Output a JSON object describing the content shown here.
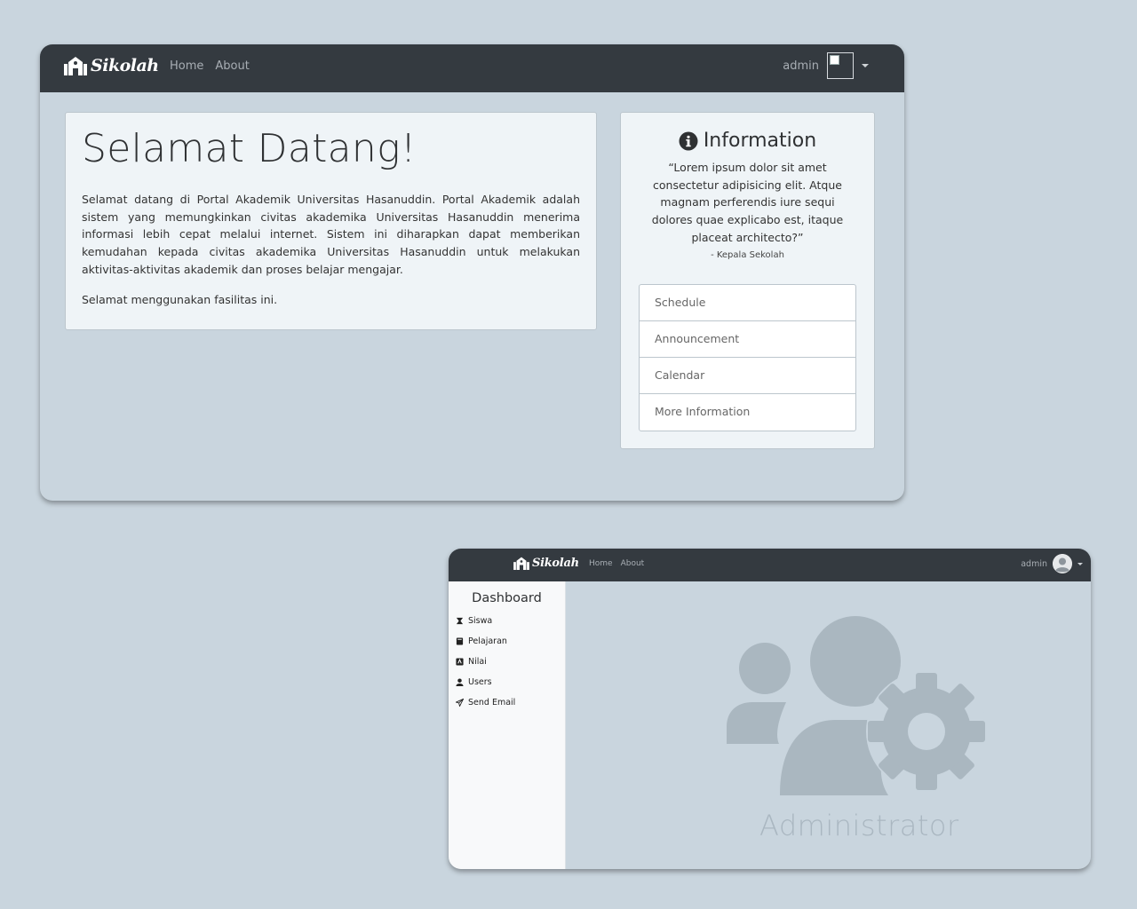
{
  "home_window": {
    "navbar": {
      "brand": "Sikolah",
      "links": [
        "Home",
        "About"
      ],
      "user_name": "admin"
    },
    "welcome": {
      "heading": "Selamat Datang!",
      "paragraph1": "Selamat datang di Portal Akademik Universitas Hasanuddin. Portal Akademik adalah sistem yang memungkinkan civitas akademika Universitas Hasanuddin menerima informasi lebih cepat melalui internet. Sistem ini diharapkan dapat memberikan kemudahan kepada civitas akademika Universitas Hasanuddin untuk melakukan aktivitas-aktivitas akademik dan proses belajar mengajar.",
      "paragraph2": "Selamat menggunakan fasilitas ini."
    },
    "info": {
      "title": "Information",
      "quote": "“Lorem ipsum dolor sit amet consectetur adipisicing elit. Atque magnam perferendis iure sequi dolores quae explicabo est, itaque placeat architecto?”",
      "author": "- Kepala Sekolah",
      "links": [
        "Schedule",
        "Announcement",
        "Calendar",
        "More Information"
      ]
    }
  },
  "admin_window": {
    "navbar": {
      "brand": "Sikolah",
      "links": [
        "Home",
        "About"
      ],
      "user_name": "admin"
    },
    "sidebar": {
      "title": "Dashboard",
      "items": [
        {
          "label": "Siswa",
          "icon": "user-graduate-icon"
        },
        {
          "label": "Pelajaran",
          "icon": "book-icon"
        },
        {
          "label": "Nilai",
          "icon": "grade-card-icon"
        },
        {
          "label": "Users",
          "icon": "user-icon"
        },
        {
          "label": "Send Email",
          "icon": "paper-plane-icon"
        }
      ]
    },
    "main": {
      "label": "Administrator",
      "icon": "users-cog-icon"
    }
  }
}
